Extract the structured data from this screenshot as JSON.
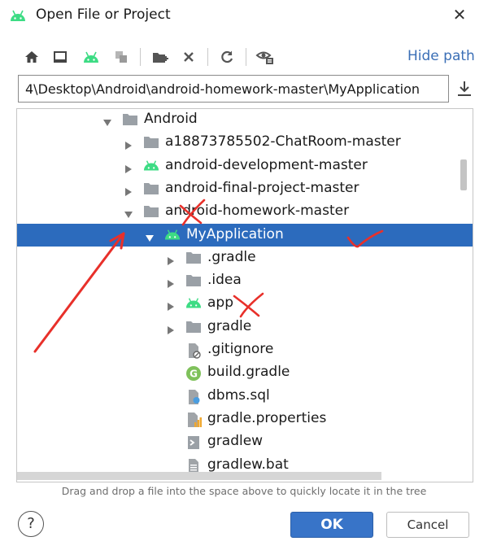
{
  "dialog": {
    "title": "Open File or Project",
    "title_icon": "android-icon",
    "close_glyph": "✕"
  },
  "toolbar": {
    "buttons": [
      "home-icon",
      "desktop-icon",
      "android-project-icon",
      "module-icon",
      "new-folder-icon",
      "delete-icon",
      "refresh-icon",
      "show-hidden-icon"
    ],
    "hide_path_label": "Hide path"
  },
  "path": {
    "value": "4\\Desktop\\Android\\android-homework-master\\MyApplication"
  },
  "tree": {
    "nodes": [
      {
        "label": "Android",
        "icon": "folder-icon",
        "expanded": true
      },
      {
        "label": "a18873785502-ChatRoom-master",
        "icon": "folder-icon",
        "expanded": false
      },
      {
        "label": "android-development-master",
        "icon": "android-icon",
        "expanded": false
      },
      {
        "label": "android-final-project-master",
        "icon": "folder-icon",
        "expanded": false
      },
      {
        "label": "android-homework-master",
        "icon": "folder-icon",
        "expanded": true
      },
      {
        "label": "MyApplication",
        "icon": "android-icon",
        "expanded": true,
        "selected": true
      },
      {
        "label": ".gradle",
        "icon": "folder-icon",
        "expanded": false
      },
      {
        "label": ".idea",
        "icon": "folder-icon",
        "expanded": false
      },
      {
        "label": "app",
        "icon": "android-icon",
        "expanded": false
      },
      {
        "label": "gradle",
        "icon": "folder-icon",
        "expanded": false
      },
      {
        "label": ".gitignore",
        "icon": "ignored-file-icon"
      },
      {
        "label": "build.gradle",
        "icon": "gradle-file-icon"
      },
      {
        "label": "dbms.sql",
        "icon": "sql-file-icon"
      },
      {
        "label": "gradle.properties",
        "icon": "properties-file-icon"
      },
      {
        "label": "gradlew",
        "icon": "shell-file-icon"
      },
      {
        "label": "gradlew.bat",
        "icon": "text-file-icon"
      }
    ]
  },
  "hint": "Drag and drop a file into the space above to quickly locate it in the tree",
  "buttons": {
    "help": "?",
    "ok": "OK",
    "cancel": "Cancel"
  },
  "colors": {
    "selection": "#2c6bbd",
    "android_green": "#3ddc84",
    "folder": "#9aa0a6",
    "ok_button": "#3874c8",
    "annotation_red": "#e8302a"
  }
}
